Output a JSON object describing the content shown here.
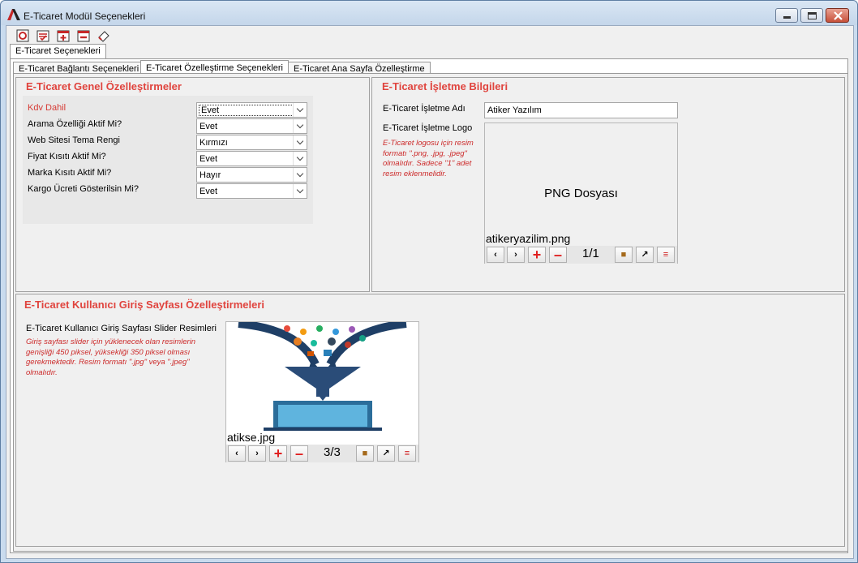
{
  "window": {
    "title": "E-Ticaret Modül Seçenekleri"
  },
  "toolbar": {
    "icons": [
      "settings-icon",
      "checklist-icon",
      "add-record-icon",
      "remove-record-icon",
      "eraser-icon"
    ]
  },
  "outer_tab": {
    "label": "E-Ticaret Seçenekleri"
  },
  "tabs": [
    {
      "label": "E-Ticaret Bağlantı Seçenekleri"
    },
    {
      "label": "E-Ticaret Özelleştirme Seçenekleri"
    },
    {
      "label": "E-Ticaret Ana Sayfa Özelleştirme"
    }
  ],
  "general": {
    "title": "E-Ticaret Genel Özelleştirmeler",
    "rows": [
      {
        "label": "Kdv Dahil",
        "value": "Evet"
      },
      {
        "label": "Arama Özelliği Aktif Mi?",
        "value": "Evet"
      },
      {
        "label": "Web Sitesi Tema Rengi",
        "value": "Kırmızı"
      },
      {
        "label": "Fiyat Kısıtı Aktif Mi?",
        "value": "Evet"
      },
      {
        "label": "Marka Kısıtı Aktif Mi?",
        "value": "Hayır"
      },
      {
        "label": "Kargo Ücreti Gösterilsin Mi?",
        "value": "Evet"
      }
    ]
  },
  "business": {
    "title": "E-Ticaret İşletme Bilgileri",
    "name_label": "E-Ticaret İşletme Adı",
    "name_value": "Atiker Yazılım",
    "logo_label": "E-Ticaret İşletme Logo",
    "logo_note": "E-Ticaret logosu için resim formatı \".png, .jpg, .jpeg\" olmalıdır. Sadece \"1\" adet resim eklenmelidir.",
    "logo_placeholder": "PNG Dosyası",
    "logo_filename": "atikeryazilim.png",
    "logo_counter": "1/1"
  },
  "login": {
    "title": "E-Ticaret Kullanıcı Giriş Sayfası Özelleştirmeleri",
    "slider_label": "E-Ticaret Kullanıcı Giriş Sayfası Slider Resimleri",
    "slider_note": "Giriş sayfası slider için yüklenecek olan resimlerin genişliği 450 piksel, yüksekliği 350 piksel olması gerekmektedir. Resim formatı \".jpg\" veya \".jpeg\" olmalıdır.",
    "slider_filename": "atikse.jpg",
    "slider_counter": "3/3"
  },
  "colors": {
    "accent_red": "#e0443e",
    "laptop_blue": "#2b6d9a"
  }
}
